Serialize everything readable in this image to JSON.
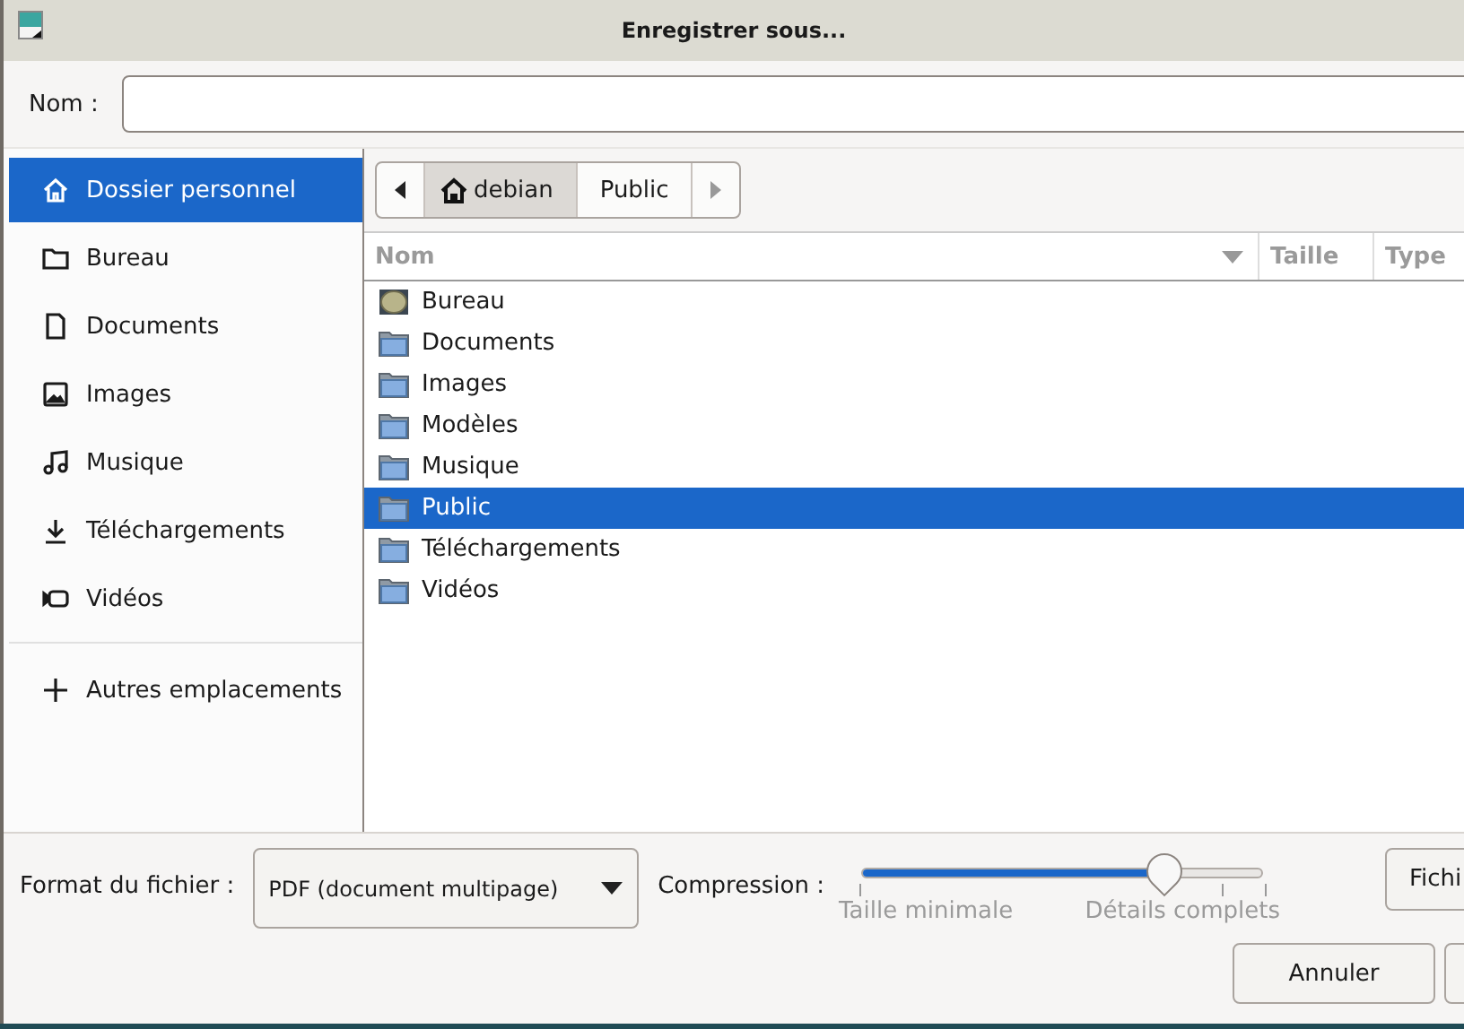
{
  "window": {
    "title": "Enregistrer sous..."
  },
  "name_field": {
    "label": "Nom :"
  },
  "sidebar": {
    "items": [
      {
        "label": "Dossier personnel",
        "selected": true
      },
      {
        "label": "Bureau",
        "selected": false
      },
      {
        "label": "Documents",
        "selected": false
      },
      {
        "label": "Images",
        "selected": false
      },
      {
        "label": "Musique",
        "selected": false
      },
      {
        "label": "Téléchargements",
        "selected": false
      },
      {
        "label": "Vidéos",
        "selected": false
      }
    ],
    "other": {
      "label": "Autres emplacements"
    }
  },
  "path_bar": {
    "segments": [
      {
        "label": "debian",
        "selected": true
      },
      {
        "label": "Public",
        "selected": false
      }
    ]
  },
  "file_list": {
    "columns": [
      {
        "label": "Nom"
      },
      {
        "label": "Taille"
      },
      {
        "label": "Type"
      }
    ],
    "rows": [
      {
        "name": "Bureau",
        "kind": "desktop",
        "selected": false
      },
      {
        "name": "Documents",
        "kind": "folder",
        "selected": false
      },
      {
        "name": "Images",
        "kind": "folder",
        "selected": false
      },
      {
        "name": "Modèles",
        "kind": "folder",
        "selected": false
      },
      {
        "name": "Musique",
        "kind": "folder",
        "selected": false
      },
      {
        "name": "Public",
        "kind": "folder",
        "selected": true
      },
      {
        "name": "Téléchargements",
        "kind": "folder",
        "selected": false
      },
      {
        "name": "Vidéos",
        "kind": "folder",
        "selected": false
      }
    ]
  },
  "options": {
    "format_label": "Format du fichier :",
    "format_value": "PDF (document multipage)",
    "compression_label": "Compression :",
    "compression": {
      "level": 0.75,
      "min_label": "Taille minimale",
      "max_label": "Détails complets"
    },
    "side_button": "Fichi"
  },
  "buttons": [
    "Annuler"
  ]
}
